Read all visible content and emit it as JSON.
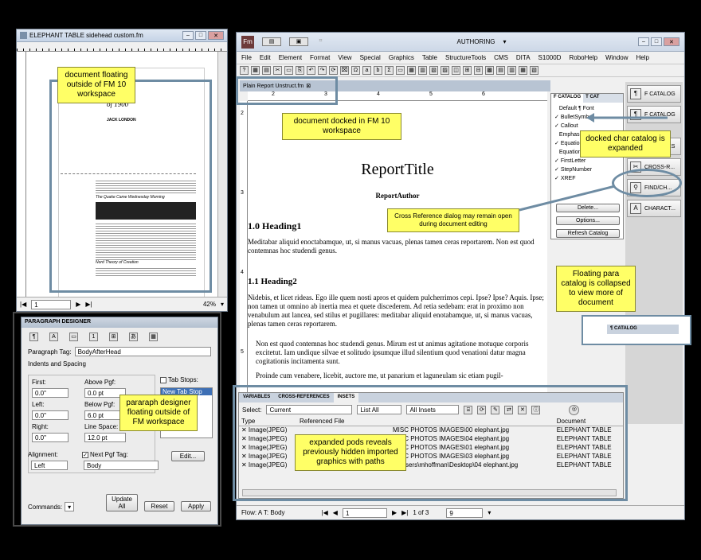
{
  "elephant_window": {
    "title": "ELEPHANT TABLE sidehead custom.fm",
    "page_field": "1",
    "zoom": "42%",
    "snippets": [
      "of 1900",
      "JACK LONDON",
      "The Quake Came Wednesday Morning",
      "Nord Theory of Creation"
    ]
  },
  "para_designer": {
    "title": "PARAGRAPH DESIGNER",
    "para_tag_label": "Paragraph Tag:",
    "para_tag_value": "BodyAfterHead",
    "indents_label": "Indents and Spacing",
    "first_label": "First:",
    "first_value": "0.0\"",
    "above_label": "Above Pgf:",
    "above_value": "0.0 pt",
    "left_label": "Left:",
    "left_value": "0.0\"",
    "below_label": "Below Pgf:",
    "below_value": "6.0 pt",
    "right_label": "Right:",
    "right_value": "0.0\"",
    "linespace_label": "Line Space:",
    "linespace_value": "12.0 pt",
    "tabstops_label": "Tab Stops:",
    "tabstop_selected": "New Tab Stop",
    "alignment_label": "Alignment:",
    "alignment_value": "Left",
    "nextpgf_label": "Next Pgf Tag:",
    "nextpgf_value": "Body",
    "edit_btn": "Edit...",
    "commands_label": "Commands:",
    "update_all": "Update All",
    "reset": "Reset",
    "apply": "Apply"
  },
  "main_window": {
    "workspace": "AUTHORING",
    "menus": [
      "File",
      "Edit",
      "Element",
      "Format",
      "View",
      "Special",
      "Graphics",
      "Table",
      "StructureTools",
      "CMS",
      "DITA",
      "S1000D",
      "RoboHelp",
      "Window",
      "Help"
    ],
    "doc_tab": "Plain Report Unstruct.fm",
    "ruler_ticks": [
      "2",
      "3",
      "4",
      "5",
      "6"
    ],
    "left_ruler_ticks": [
      "2",
      "3",
      "4",
      "5"
    ],
    "status_flow": "Flow: A  T: Body",
    "page_field": "1",
    "page_count": "1 of 3",
    "zoom_field": "9"
  },
  "document": {
    "title": "ReportTitle",
    "author": "ReportAuthor",
    "heading1": "1.0  Heading1",
    "para1": "Meditabar aliquid enoctabamque, ut, si manus vacuas, plenas tamen ceras reportarem. Non est quod contemnas hoc studendi genus.",
    "heading2": "1.1  Heading2",
    "para2": "Nidebis, et licet rideas. Ego ille quem nosti apros et quidem pulcherrimos cepi. Ipse? Ipse? Aquis. Ipse; non tamen ut omnino ab inertia mea et quete discederem. Ad retia sedebam: erat in proximo non venabulum aut lancea, sed stilus et pugillares: meditabar aliquid enotabamque, ut, si manus vacuas, plenas tamen ceras reportarem.",
    "para3": "Non est quod contemnas hoc studendi genus. Mirum est ut animus agitatione motuque corporis excitetut. Iam undique silvae et solitudo ipsumque illud silentium quod venationi datur magna cogitationis incitamenta sunt.",
    "para4": "Proinde cum venabere, licebit, auctore me, ut panarium et laguneulam sic etiam pugil-"
  },
  "char_catalog": {
    "tab1": "F CATALOG",
    "tab2": "T CAT",
    "items": [
      {
        "label": "Default ¶ Font",
        "checked": false
      },
      {
        "label": "BulletSymbol",
        "checked": true
      },
      {
        "label": "Callout",
        "checked": true
      },
      {
        "label": "Emphasis",
        "checked": false
      },
      {
        "label": "Equation",
        "checked": true
      },
      {
        "label": "Equation",
        "checked": false
      },
      {
        "label": "FirstLetter",
        "checked": true
      },
      {
        "label": "StepNumber",
        "checked": true
      },
      {
        "label": "XREF",
        "checked": true
      }
    ],
    "delete_btn": "Delete...",
    "options_btn": "Options...",
    "refresh_btn": "Refresh Catalog"
  },
  "side_pods": [
    {
      "label": "F CATALOG",
      "icon": "f-catalog-icon"
    },
    {
      "label": "F CATALOG",
      "icon": "f-catalog-icon"
    },
    {
      "label": "VARIABLES",
      "icon": "variables-icon"
    },
    {
      "label": "CROSS-R...",
      "icon": "cross-ref-icon"
    },
    {
      "label": "FIND/CH...",
      "icon": "find-icon"
    },
    {
      "label": "CHARACT...",
      "icon": "character-icon"
    }
  ],
  "floating_pcatalog": {
    "label": "¶ CATALOG"
  },
  "bottom_pods": {
    "tabs": [
      "VARIABLES",
      "CROSS-REFERENCES",
      "INSETS"
    ],
    "select_label": "Select:",
    "select_value": "Current",
    "list_value": "List All",
    "insets_value": "All Insets",
    "columns": [
      "Type",
      "Referenced File",
      "Document"
    ],
    "rows": [
      {
        "type": "Image(JPEG)",
        "file": "MISC PHOTOS IMAGES\\00 elephant.jpg",
        "doc": "ELEPHANT TABLE"
      },
      {
        "type": "Image(JPEG)",
        "file": "MISC PHOTOS IMAGES\\04 elephant.jpg",
        "doc": "ELEPHANT TABLE"
      },
      {
        "type": "Image(JPEG)",
        "file": "MISC PHOTOS IMAGES\\01 elephant.jpg",
        "doc": "ELEPHANT TABLE"
      },
      {
        "type": "Image(JPEG)",
        "file": "MISC PHOTOS IMAGES\\03 elephant.jpg",
        "doc": "ELEPHANT TABLE"
      },
      {
        "type": "Image(JPEG)",
        "file": "C:\\Users\\mhoffman\\Desktop\\04 elephant.jpg",
        "doc": "ELEPHANT TABLE"
      }
    ]
  },
  "callouts": {
    "floating_doc": "document floating outside of FM 10 workspace",
    "docked_doc": "document docked in FM 10 workspace",
    "char_catalog": "docked char catalog is expanded",
    "cross_ref": "Cross Reference dialog may remain open during document editing",
    "para_catalog": "Floating para catalog is collapsed to view more of document",
    "para_designer": "pararaph designer floating outside of FM workspace",
    "pods": "expanded pods reveals previously hidden imported graphics with paths"
  }
}
